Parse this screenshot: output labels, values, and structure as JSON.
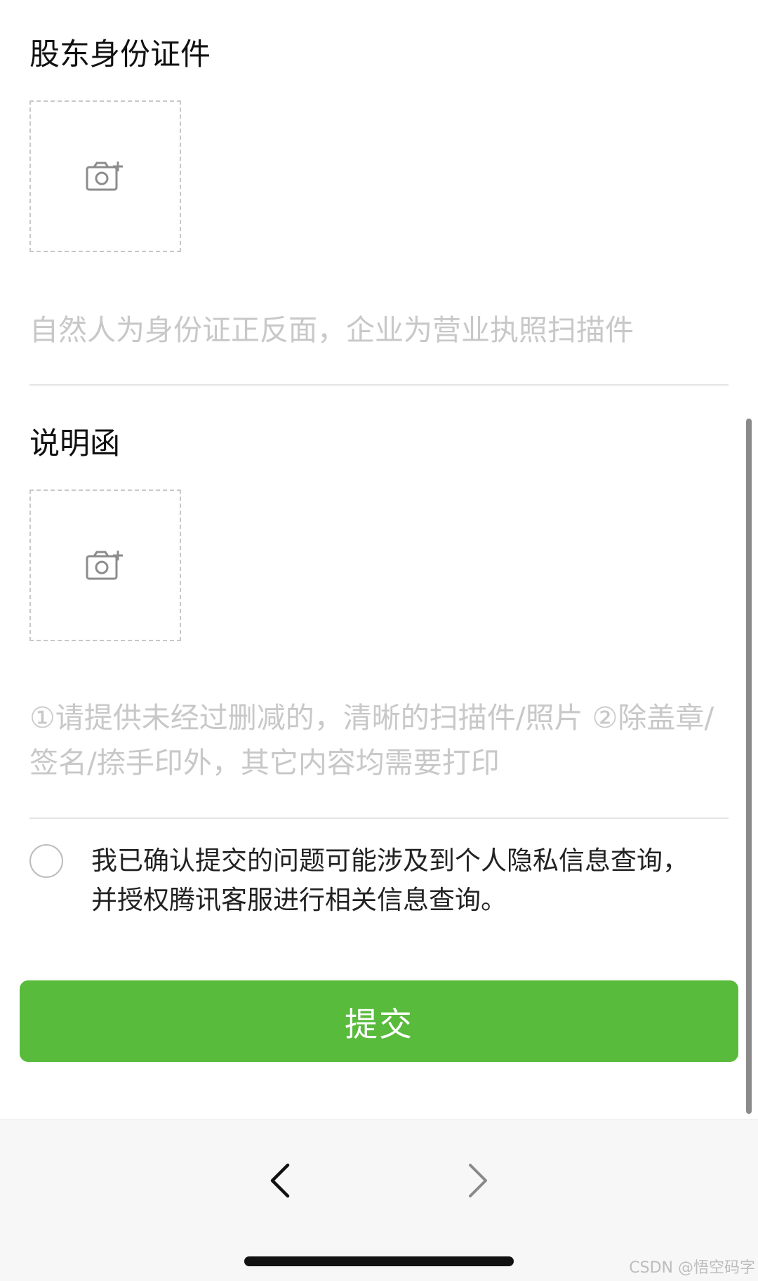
{
  "sections": [
    {
      "title": "股东身份证件",
      "placeholder": "自然人为身份证正反面，企业为营业执照扫描件"
    },
    {
      "title": "说明函",
      "placeholder": "①请提供未经过删减的，清晰的扫描件/照片 ②除盖章/签名/捺手印外，其它内容均需要打印"
    }
  ],
  "consent": {
    "text": "我已确认提交的问题可能涉及到个人隐私信息查询，并授权腾讯客服进行相关信息查询。",
    "checked": false
  },
  "submit": {
    "label": "提交",
    "color": "#58bb3c"
  },
  "icons": {
    "upload": "camera-add-icon",
    "back": "chevron-left-icon",
    "forward": "chevron-right-icon"
  },
  "watermark": "CSDN @悟空码字"
}
